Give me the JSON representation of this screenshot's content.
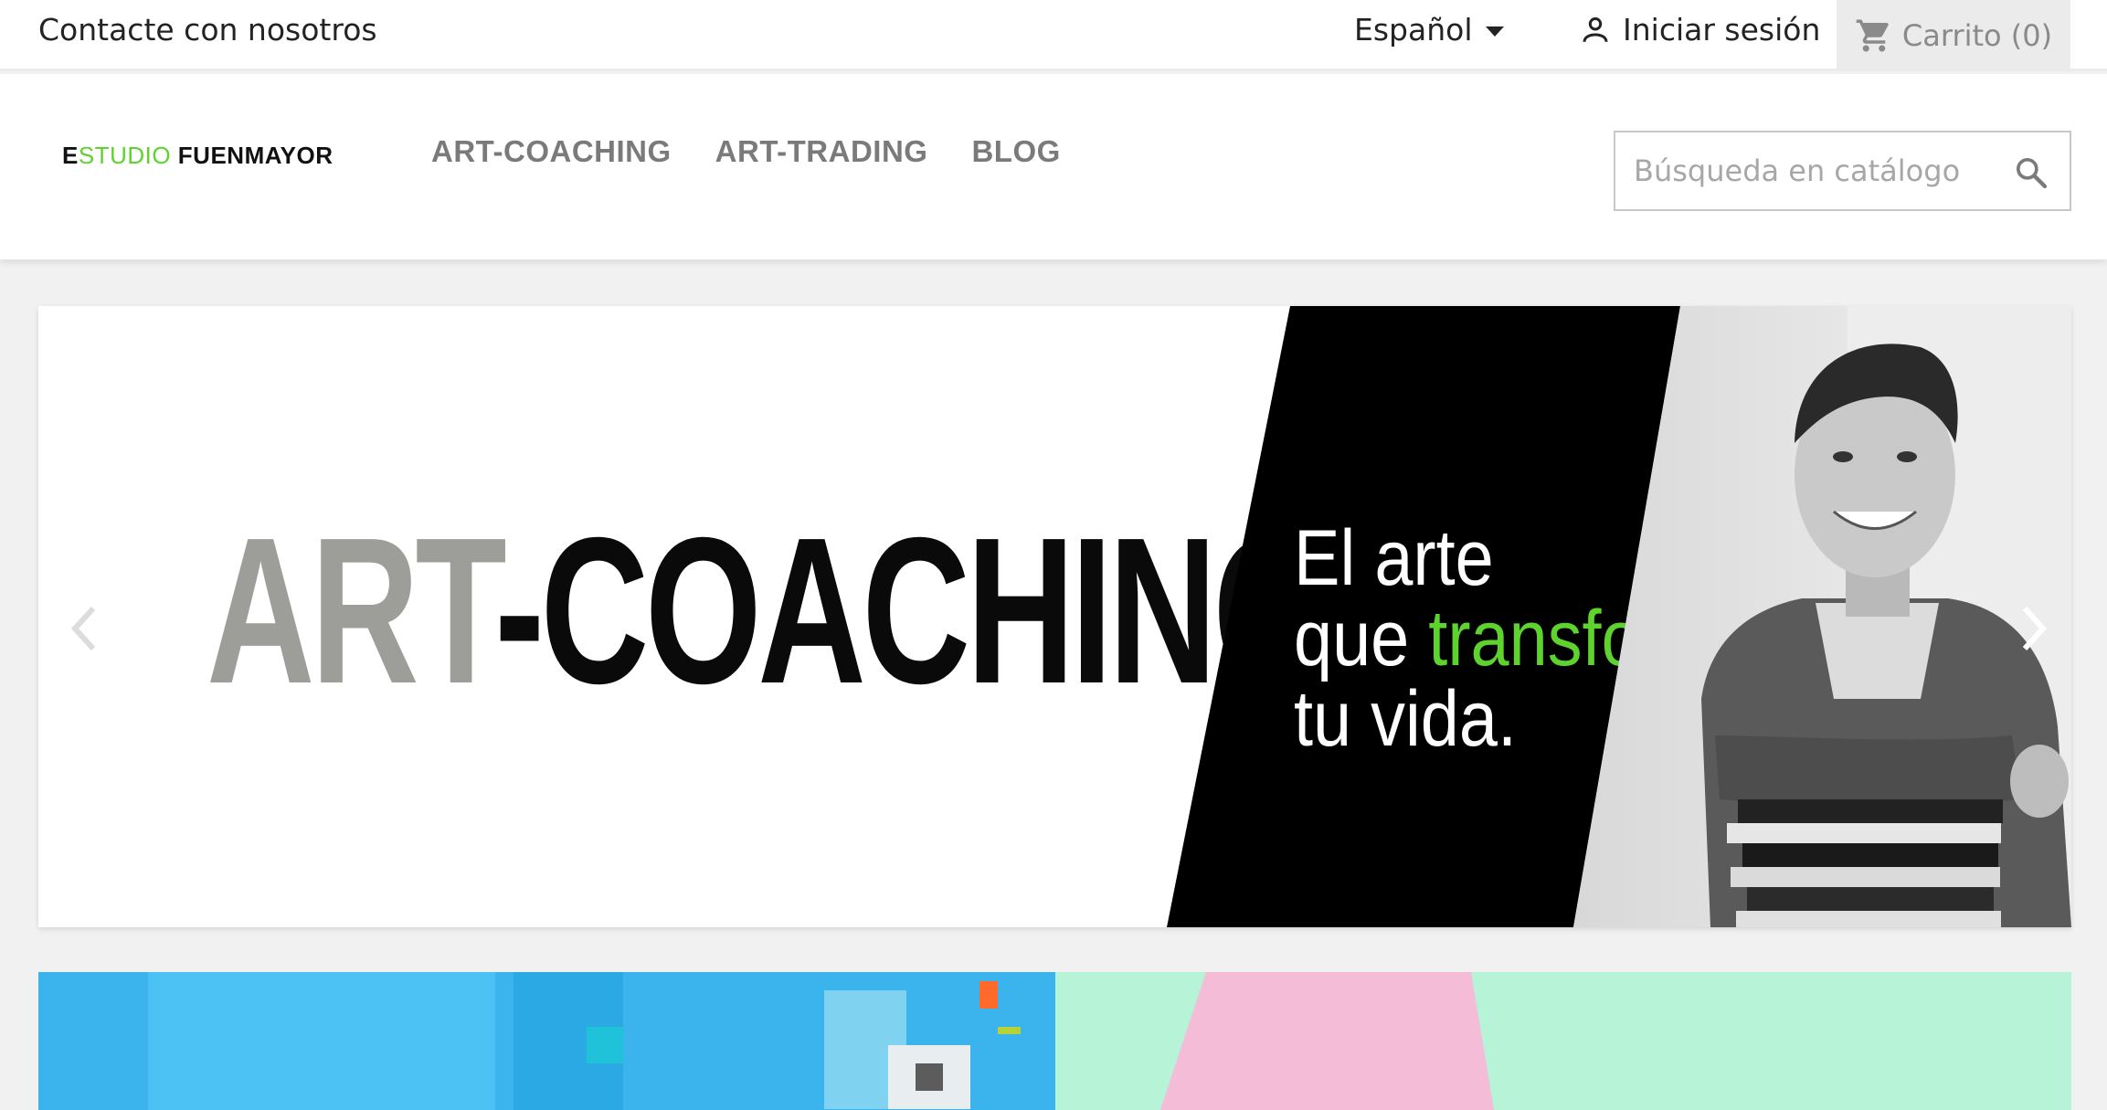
{
  "topbar": {
    "contact_label": "Contacte con nosotros",
    "language": "Español",
    "login_label": "Iniciar sesión",
    "cart_label": "Carrito",
    "cart_count": "(0)"
  },
  "header": {
    "logo_first": "E",
    "logo_green": "STUDIO",
    "logo_rest": " FUENMAYOR",
    "nav": [
      "ART-COACHING",
      "ART-TRADING",
      "BLOG"
    ],
    "search_placeholder": "Búsqueda en catálogo"
  },
  "hero": {
    "title_grey": "ART",
    "title_black": "-COACHING",
    "tagline_line1": "El arte",
    "tagline_line2_a": "que ",
    "tagline_line2_b": "transformará",
    "tagline_line3": "tu vida."
  },
  "colors": {
    "accent": "#5ed32e",
    "nav_text": "#7a7a7a",
    "cart_bg": "#ebebeb",
    "page_bg": "#f1f1f1"
  },
  "icons": [
    "caret-down-icon",
    "user-icon",
    "cart-icon",
    "search-icon",
    "chevron-left-icon",
    "chevron-right-icon"
  ]
}
